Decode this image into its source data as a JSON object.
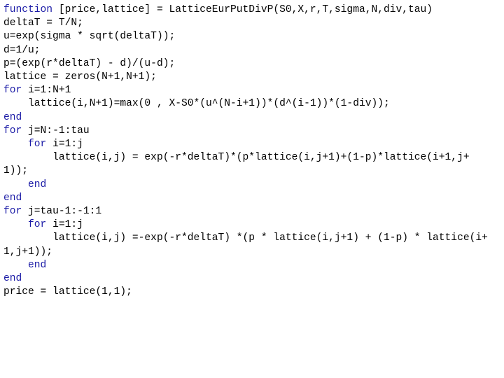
{
  "document": {
    "type": "source-code-listing",
    "language": "MATLAB",
    "function_name": "LatticeEurPutDivP",
    "background_color": "#ffffff",
    "text_color": "#000000",
    "keyword_color": "#1a1aa6",
    "keywords": [
      "function",
      "for",
      "end"
    ],
    "lines": [
      {
        "indent": "",
        "keyword": "function",
        "rest": " [price,lattice] = LatticeEurPutDivP(S0,X,r,T,sigma,N,div,tau)"
      },
      {
        "indent": "",
        "keyword": "",
        "rest": "deltaT = T/N;"
      },
      {
        "indent": "",
        "keyword": "",
        "rest": "u=exp(sigma * sqrt(deltaT));"
      },
      {
        "indent": "",
        "keyword": "",
        "rest": "d=1/u;"
      },
      {
        "indent": "",
        "keyword": "",
        "rest": "p=(exp(r*deltaT) - d)/(u-d);"
      },
      {
        "indent": "",
        "keyword": "",
        "rest": "lattice = zeros(N+1,N+1);"
      },
      {
        "indent": "",
        "keyword": "for",
        "rest": " i=1:N+1"
      },
      {
        "indent": "    ",
        "keyword": "",
        "rest": "lattice(i,N+1)=max(0 , X-S0*(u^(N-i+1))*(d^(i-1))*(1-div));"
      },
      {
        "indent": "",
        "keyword": "end",
        "rest": ""
      },
      {
        "indent": "",
        "keyword": "for",
        "rest": " j=N:-1:tau"
      },
      {
        "indent": "    ",
        "keyword": "for",
        "rest": " i=1:j"
      },
      {
        "indent": "        ",
        "keyword": "",
        "rest": "lattice(i,j) = exp(-r*deltaT)*(p*lattice(i,j+1)+(1-p)*lattice(i+1,j+1));"
      },
      {
        "indent": "    ",
        "keyword": "end",
        "rest": ""
      },
      {
        "indent": "",
        "keyword": "end",
        "rest": ""
      },
      {
        "indent": "",
        "keyword": "for",
        "rest": " j=tau-1:-1:1"
      },
      {
        "indent": "    ",
        "keyword": "for",
        "rest": " i=1:j"
      },
      {
        "indent": "        ",
        "keyword": "",
        "rest": "lattice(i,j) =-exp(-r*deltaT) *(p * lattice(i,j+1) + (1-p) * lattice(i+1,j+1));"
      },
      {
        "indent": "    ",
        "keyword": "end",
        "rest": ""
      },
      {
        "indent": "",
        "keyword": "end",
        "rest": ""
      },
      {
        "indent": "",
        "keyword": "",
        "rest": "price = lattice(1,1);"
      }
    ]
  }
}
